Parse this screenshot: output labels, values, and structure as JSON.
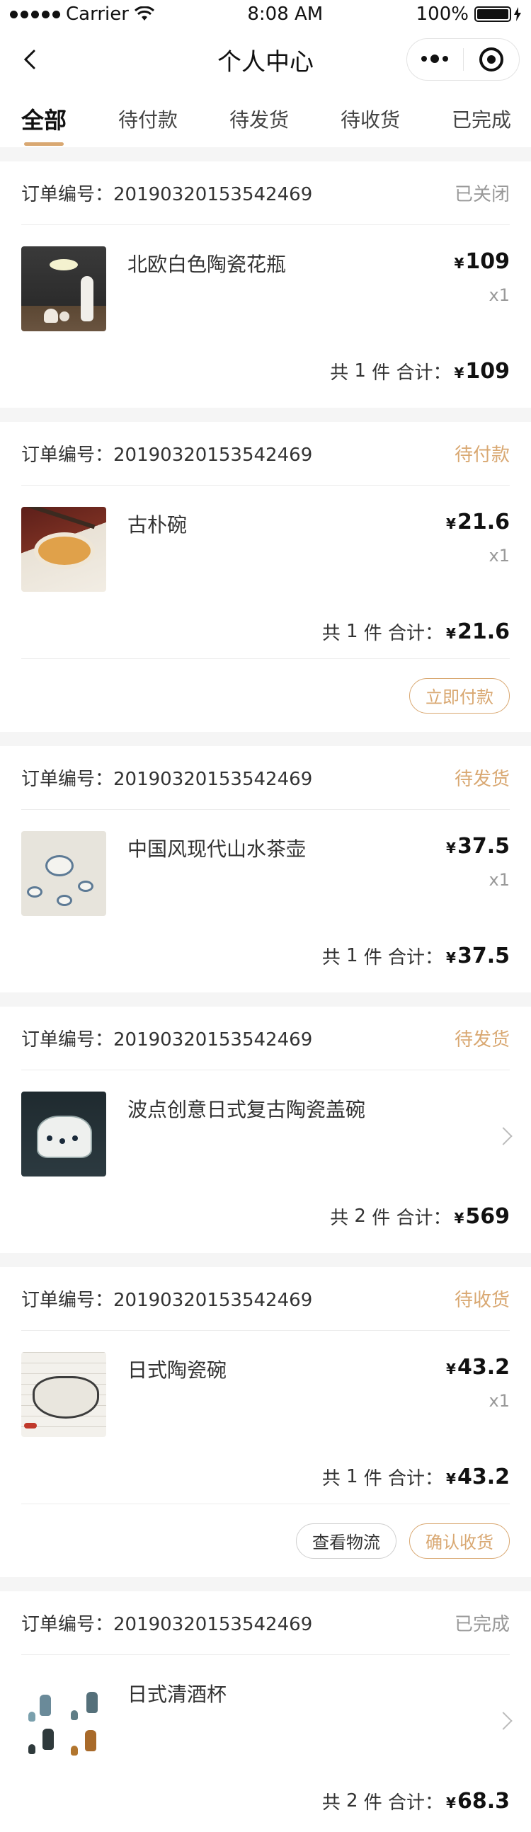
{
  "status_bar": {
    "carrier": "Carrier",
    "time": "8:08 AM",
    "battery": "100%"
  },
  "nav": {
    "title": "个人中心"
  },
  "tabs": [
    {
      "label": "全部",
      "active": true
    },
    {
      "label": "待付款",
      "active": false
    },
    {
      "label": "待发货",
      "active": false
    },
    {
      "label": "待收货",
      "active": false
    },
    {
      "label": "已完成",
      "active": false
    }
  ],
  "currency": "¥",
  "labels": {
    "order_no_prefix": "订单编号：",
    "total_prefix": "共",
    "total_unit": "件 合计：",
    "qty_prefix": "x"
  },
  "orders": [
    {
      "order_no": "20190320153542469",
      "status": "已关闭",
      "item_name": "北欧白色陶瓷花瓶",
      "price": "109",
      "qty": "1",
      "total_count": "1",
      "total_amount": "109"
    },
    {
      "order_no": "20190320153542469",
      "status": "待付款",
      "item_name": "古朴碗",
      "price": "21.6",
      "qty": "1",
      "total_count": "1",
      "total_amount": "21.6",
      "action_primary": "立即付款"
    },
    {
      "order_no": "20190320153542469",
      "status": "待发货",
      "item_name": "中国风现代山水茶壶",
      "price": "37.5",
      "qty": "1",
      "total_count": "1",
      "total_amount": "37.5"
    },
    {
      "order_no": "20190320153542469",
      "status": "待发货",
      "item_name": "波点创意日式复古陶瓷盖碗",
      "total_count": "2",
      "total_amount": "569"
    },
    {
      "order_no": "20190320153542469",
      "status": "待收货",
      "item_name": "日式陶瓷碗",
      "price": "43.2",
      "qty": "1",
      "total_count": "1",
      "total_amount": "43.2",
      "action_secondary": "查看物流",
      "action_primary": "确认收货"
    },
    {
      "order_no": "20190320153542469",
      "status": "已完成",
      "item_name": "日式清酒杯",
      "total_count": "2",
      "total_amount": "68.3"
    }
  ],
  "colors": {
    "accent": "#d9a872",
    "muted": "#999999",
    "page_bg": "#f5f5f5"
  },
  "icons": [
    "signal-dots-icon",
    "wifi-icon",
    "battery-icon",
    "back-arrow-icon",
    "more-dots-icon",
    "close-target-icon",
    "chevron-right-icon"
  ]
}
